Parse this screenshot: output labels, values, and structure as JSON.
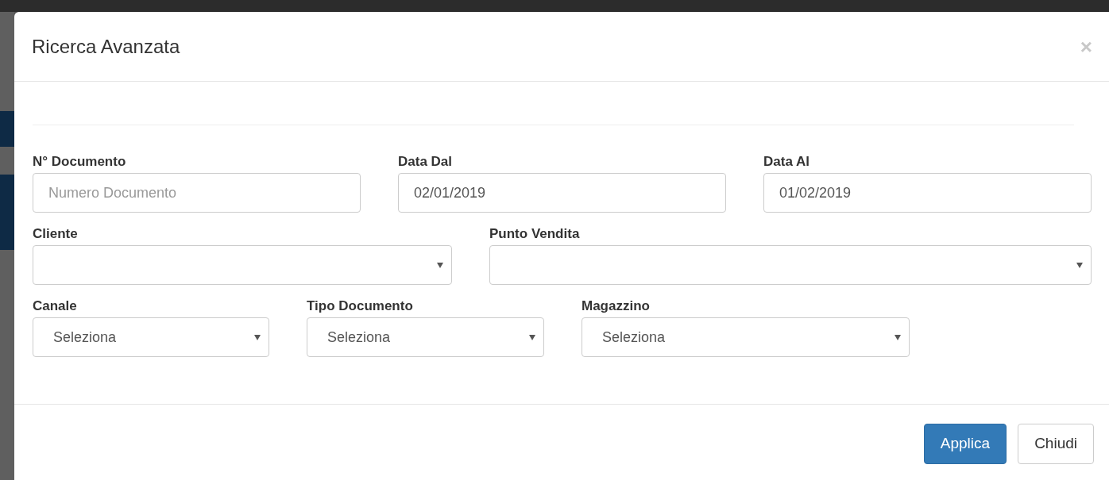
{
  "modal": {
    "title": "Ricerca Avanzata",
    "close": "×"
  },
  "rows": [
    [
      {
        "kind": "text",
        "label": "N° Documento",
        "placeholder": "Numero Documento"
      },
      {
        "kind": "text",
        "label": "Data Dal",
        "value": "02/01/2019"
      },
      {
        "kind": "text",
        "label": "Data Al",
        "value": "01/02/2019"
      }
    ],
    [
      {
        "kind": "select",
        "label": "Cliente"
      },
      {
        "kind": "select",
        "label": "Punto Vendita"
      }
    ],
    [
      {
        "kind": "select",
        "label": "Canale",
        "value": "Seleziona"
      },
      {
        "kind": "select",
        "label": "Tipo Documento",
        "value": "Seleziona"
      },
      {
        "kind": "select",
        "label": "Magazzino",
        "value": "Seleziona"
      }
    ]
  ],
  "buttons": [
    {
      "kind": "primary",
      "label": "Applica"
    },
    {
      "kind": "default",
      "label": "Chiudi"
    }
  ]
}
